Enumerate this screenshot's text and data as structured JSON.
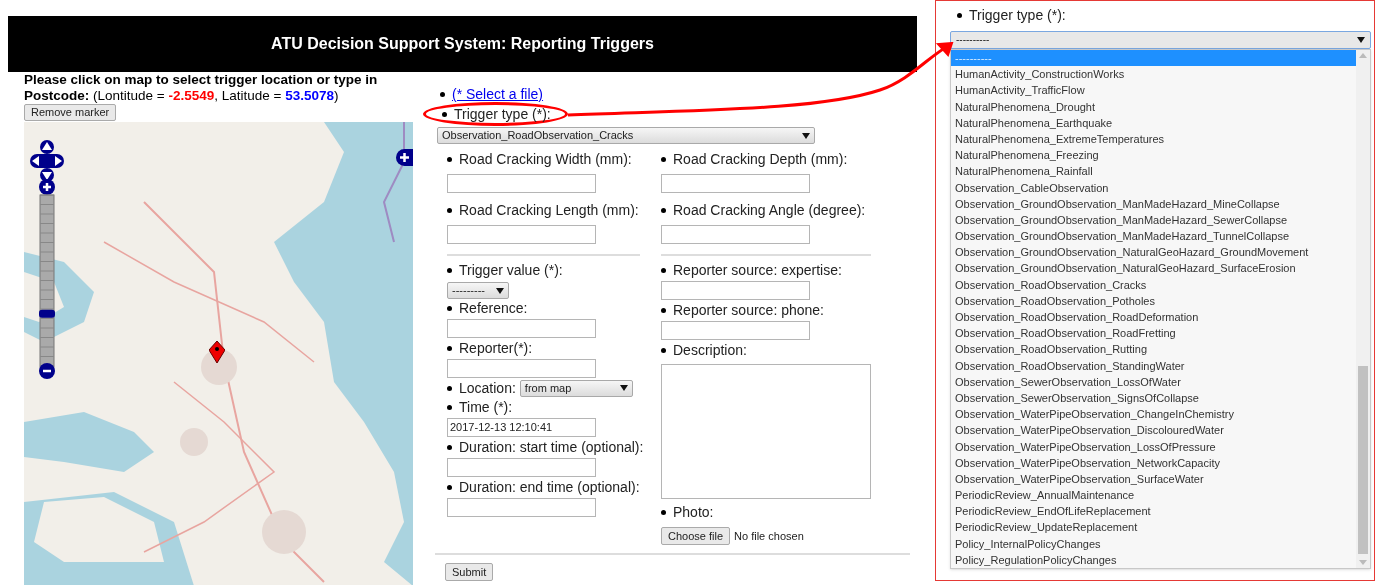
{
  "header": {
    "title": "ATU Decision Support System: Reporting Triggers"
  },
  "map_panel": {
    "instruction": "Please click on map to select trigger location or type in Postcode:",
    "longitude_label": "(Lontitude = ",
    "longitude": "-2.5549",
    "latitude_label": ", Latitude = ",
    "latitude": "53.5078",
    "closing": ")",
    "remove_button": "Remove marker",
    "map": {
      "kind": "picture",
      "zoom": {
        "level": 0.31
      }
    }
  },
  "form": {
    "file_link": "(* Select a file)",
    "trigger_type": {
      "label": "Trigger type (*):",
      "value": "Observation_RoadObservation_Cracks",
      "highlighted": true
    },
    "measurements": [
      {
        "label": "Road Cracking Width (mm):"
      },
      {
        "label": "Road Cracking Depth (mm):"
      },
      {
        "label": "Road Cracking Length (mm):"
      },
      {
        "label": "Road Cracking Angle (degree):"
      }
    ],
    "details_left": [
      {
        "kind": "select",
        "label": "Trigger value (*):",
        "value": "---------"
      },
      {
        "kind": "input",
        "label": "Reference:"
      },
      {
        "kind": "input",
        "label": "Reporter(*):"
      },
      {
        "kind": "inline_select",
        "label": "Location:",
        "value": "from map"
      },
      {
        "kind": "input",
        "label": "Time (*):",
        "value": "2017-12-13 12:10:41"
      },
      {
        "kind": "input",
        "label": "Duration: start time (optional):"
      },
      {
        "kind": "input",
        "label": "Duration: end time (optional):"
      }
    ],
    "details_right": [
      {
        "kind": "input",
        "label": "Reporter source: expertise:"
      },
      {
        "kind": "input",
        "label": "Reporter source: phone:"
      },
      {
        "kind": "textarea",
        "label": "Description:"
      },
      {
        "kind": "file",
        "label": "Photo:",
        "button": "Choose file",
        "status": "No file chosen"
      }
    ],
    "submit": "Submit"
  },
  "callout": {
    "label": "Trigger type (*):",
    "value": "----------",
    "options": [
      {
        "label": "----------",
        "selected": true
      },
      {
        "label": "HumanActivity_ConstructionWorks",
        "selected": false
      },
      {
        "label": "HumanActivity_TrafficFlow",
        "selected": false
      },
      {
        "label": "NaturalPhenomena_Drought",
        "selected": false
      },
      {
        "label": "NaturalPhenomena_Earthquake",
        "selected": false
      },
      {
        "label": "NaturalPhenomena_ExtremeTemperatures",
        "selected": false
      },
      {
        "label": "NaturalPhenomena_Freezing",
        "selected": false
      },
      {
        "label": "NaturalPhenomena_Rainfall",
        "selected": false
      },
      {
        "label": "Observation_CableObservation",
        "selected": false
      },
      {
        "label": "Observation_GroundObservation_ManMadeHazard_MineCollapse",
        "selected": false
      },
      {
        "label": "Observation_GroundObservation_ManMadeHazard_SewerCollapse",
        "selected": false
      },
      {
        "label": "Observation_GroundObservation_ManMadeHazard_TunnelCollapse",
        "selected": false
      },
      {
        "label": "Observation_GroundObservation_NaturalGeoHazard_GroundMovement",
        "selected": false
      },
      {
        "label": "Observation_GroundObservation_NaturalGeoHazard_SurfaceErosion",
        "selected": false
      },
      {
        "label": "Observation_RoadObservation_Cracks",
        "selected": false
      },
      {
        "label": "Observation_RoadObservation_Potholes",
        "selected": false
      },
      {
        "label": "Observation_RoadObservation_RoadDeformation",
        "selected": false
      },
      {
        "label": "Observation_RoadObservation_RoadFretting",
        "selected": false
      },
      {
        "label": "Observation_RoadObservation_Rutting",
        "selected": false
      },
      {
        "label": "Observation_RoadObservation_StandingWater",
        "selected": false
      },
      {
        "label": "Observation_SewerObservation_LossOfWater",
        "selected": false
      },
      {
        "label": "Observation_SewerObservation_SignsOfCollapse",
        "selected": false
      },
      {
        "label": "Observation_WaterPipeObservation_ChangeInChemistry",
        "selected": false
      },
      {
        "label": "Observation_WaterPipeObservation_DiscolouredWater",
        "selected": false
      },
      {
        "label": "Observation_WaterPipeObservation_LossOfPressure",
        "selected": false
      },
      {
        "label": "Observation_WaterPipeObservation_NetworkCapacity",
        "selected": false
      },
      {
        "label": "Observation_WaterPipeObservation_SurfaceWater",
        "selected": false
      },
      {
        "label": "PeriodicReview_AnnualMaintenance",
        "selected": false
      },
      {
        "label": "PeriodicReview_EndOfLifeReplacement",
        "selected": false
      },
      {
        "label": "PeriodicReview_UpdateReplacement",
        "selected": false
      },
      {
        "label": "Policy_InternalPolicyChanges",
        "selected": false
      },
      {
        "label": "Policy_RegulationPolicyChanges",
        "selected": false
      }
    ]
  }
}
